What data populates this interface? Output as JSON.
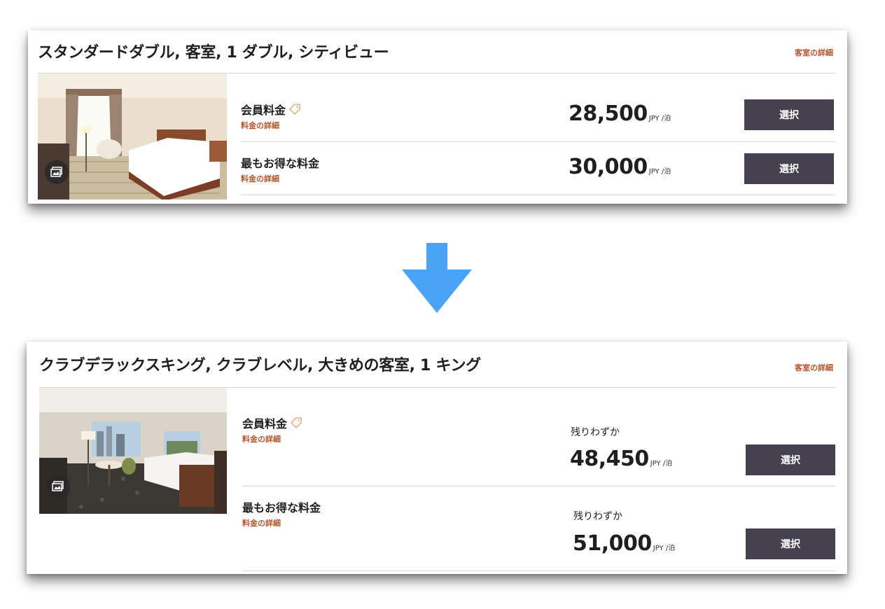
{
  "card1": {
    "title": "スタンダードダブル, 客室, 1 ダブル, シティビュー",
    "details_link": "客室の詳細",
    "rates": [
      {
        "name": "会員料金",
        "detail_link": "料金の詳細",
        "price": "28,500",
        "unit": "JPY /泊",
        "button": "選択"
      },
      {
        "name": "最もお得な料金",
        "detail_link": "料金の詳細",
        "price": "30,000",
        "unit": "JPY /泊",
        "button": "選択"
      }
    ]
  },
  "card2": {
    "title": "クラブデラックスキング, クラブレベル, 大きめの客室, 1 キング",
    "details_link": "客室の詳細",
    "rates": [
      {
        "name": "会員料金",
        "detail_link": "料金の詳細",
        "availability": "残りわずか",
        "price": "48,450",
        "unit": "JPY /泊",
        "button": "選択"
      },
      {
        "name": "最もお得な料金",
        "detail_link": "料金の詳細",
        "availability": "残りわずか",
        "price": "51,000",
        "unit": "JPY /泊",
        "button": "選択"
      }
    ]
  },
  "icons": {
    "member_rate": "tag-icon",
    "gallery": "gallery-icon",
    "transition": "arrow-down-icon"
  },
  "colors": {
    "accent_link": "#b4542a",
    "button_bg": "#45414f",
    "arrow": "#4aa3f5"
  }
}
